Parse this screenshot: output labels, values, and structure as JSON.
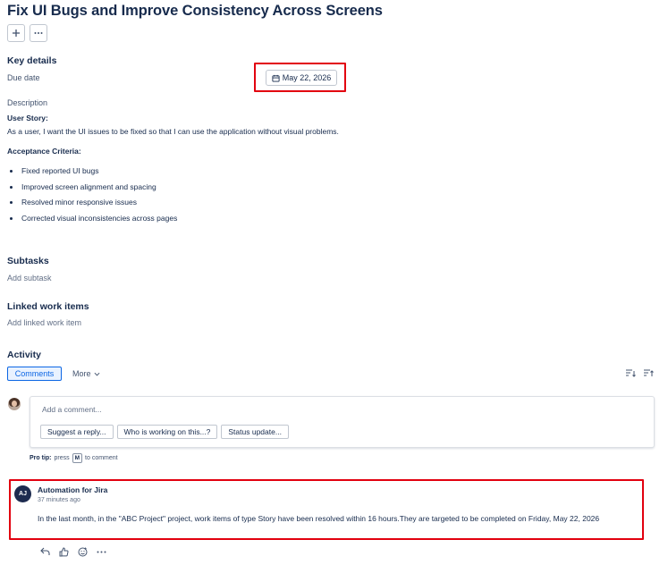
{
  "issue": {
    "title": "Fix UI Bugs and Improve Consistency Across Screens",
    "add_icon": "plus-icon",
    "more_icon": "more-icon"
  },
  "key_details": {
    "heading": "Key details",
    "due_date_label": "Due date",
    "due_date_value": "May 22, 2026",
    "due_date_icon": "calendar-icon"
  },
  "description": {
    "label": "Description",
    "user_story_heading": "User Story:",
    "user_story_text": "As a user, I want the UI issues to be fixed so that I can use the application without visual problems.",
    "acceptance_heading": "Acceptance Criteria:",
    "acceptance_items": [
      "Fixed reported UI bugs",
      "Improved screen alignment and spacing",
      "Resolved minor responsive issues",
      "Corrected visual inconsistencies across pages"
    ]
  },
  "subtasks": {
    "heading": "Subtasks",
    "add_label": "Add subtask"
  },
  "linked": {
    "heading": "Linked work items",
    "add_label": "Add linked work item"
  },
  "activity": {
    "heading": "Activity",
    "tab_comments": "Comments",
    "tab_more": "More",
    "comment_placeholder": "Add a comment...",
    "chips": [
      "Suggest a reply...",
      "Who is working on this...?",
      "Status update..."
    ],
    "protip_bold": "Pro tip:",
    "protip_press": "press",
    "protip_key": "M",
    "protip_rest": "to comment"
  },
  "automation_comment": {
    "avatar_initials": "AJ",
    "author": "Automation for Jira",
    "time": "37 minutes ago",
    "body": "In the last month, in the \"ABC Project\" project, work items of type Story have been resolved within 16 hours.They are targeted to be completed on Friday, May 22, 2026",
    "actions": [
      "reply-icon",
      "like-icon",
      "emoji-icon",
      "more-icon"
    ]
  },
  "colors": {
    "highlight": "#e2000f",
    "accent": "#0c66e4",
    "text": "#172b4d"
  }
}
